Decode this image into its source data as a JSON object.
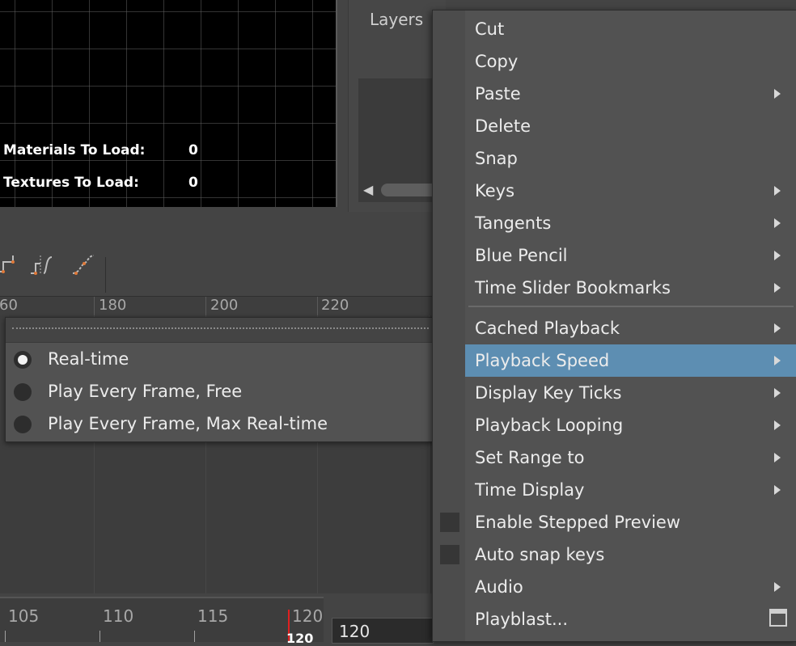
{
  "viewport": {
    "hud": [
      {
        "label": "Materials To Load:",
        "value": "0"
      },
      {
        "label": "Textures To Load:",
        "value": "0"
      }
    ]
  },
  "layers_panel": {
    "title": "Layers"
  },
  "graph_editor": {
    "ruler_labels": [
      "60",
      "180",
      "200",
      "220"
    ]
  },
  "playback_speed_submenu": {
    "options": [
      {
        "label": "Real-time",
        "selected": true
      },
      {
        "label": "Play Every Frame, Free",
        "selected": false
      },
      {
        "label": "Play Every Frame, Max Real-time",
        "selected": false
      }
    ]
  },
  "time_slider": {
    "labels": [
      "105",
      "110",
      "115",
      "120"
    ],
    "current_frame": "120",
    "current_frame_field": "120"
  },
  "context_menu": {
    "items": [
      {
        "label": "Cut"
      },
      {
        "label": "Copy"
      },
      {
        "label": "Paste"
      },
      {
        "label": "Delete"
      },
      {
        "label": "Snap"
      },
      {
        "label": "Keys"
      },
      {
        "label": "Tangents"
      },
      {
        "label": "Blue Pencil"
      },
      {
        "label": "Time Slider Bookmarks"
      },
      {
        "label": "Cached Playback"
      },
      {
        "label": "Playback Speed"
      },
      {
        "label": "Display Key Ticks"
      },
      {
        "label": "Playback Looping"
      },
      {
        "label": "Set Range to"
      },
      {
        "label": "Time Display"
      },
      {
        "label": "Enable Stepped Preview"
      },
      {
        "label": "Auto snap keys"
      },
      {
        "label": "Audio"
      },
      {
        "label": "Playblast..."
      }
    ]
  },
  "colors": {
    "menu_highlight": "#5d8eb2",
    "playhead": "#e02020",
    "key_icon_accent": "#e07a3a"
  }
}
